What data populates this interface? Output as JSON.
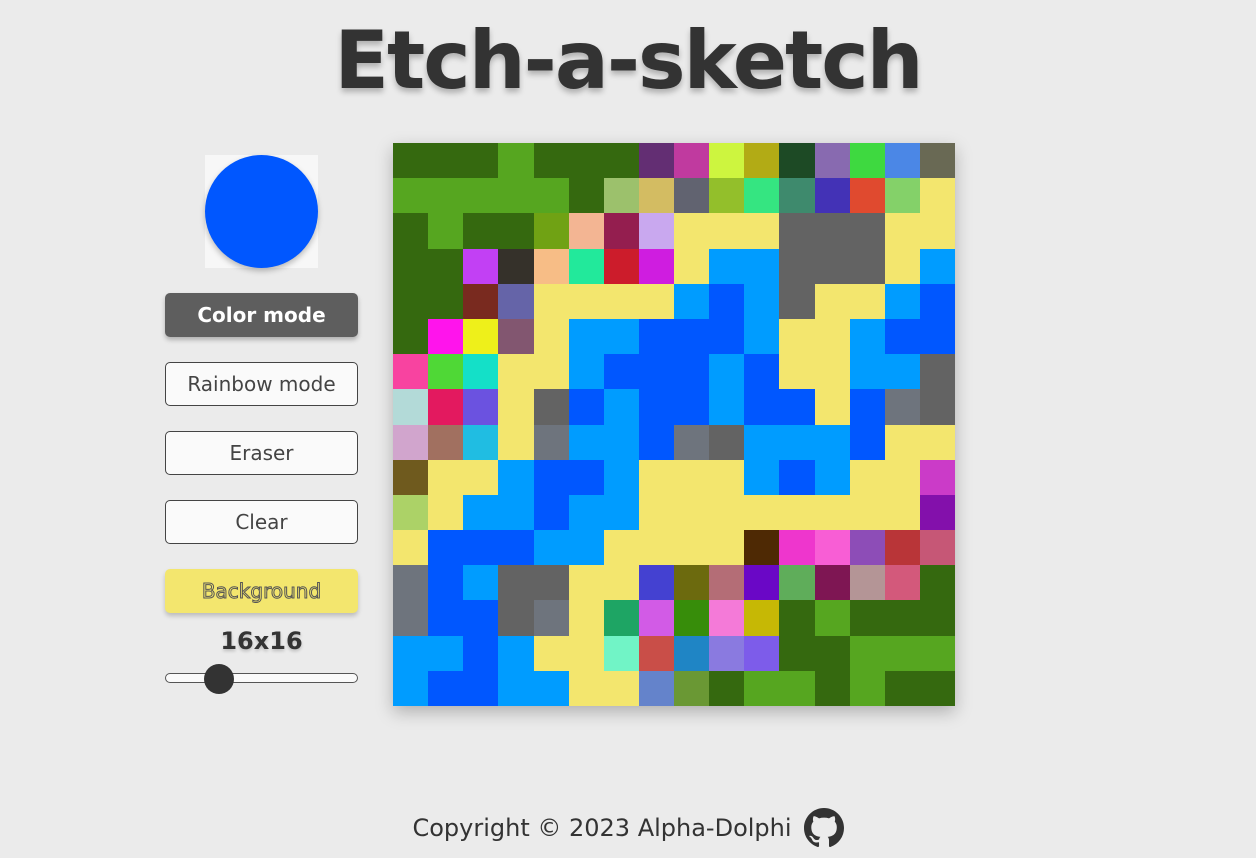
{
  "title": "Etch-a-sketch",
  "current_color": "#0057ff",
  "buttons": {
    "color_mode": "Color mode",
    "rainbow_mode": "Rainbow mode",
    "eraser": "Eraser",
    "clear": "Clear",
    "background": "Background"
  },
  "background_color": "#f3e66e",
  "grid_size_label": "16x16",
  "grid_size": 16,
  "slider": {
    "min": 1,
    "max": 64,
    "value": 16
  },
  "footer": {
    "text": "Copyright © 2023 Alpha-Dolphi",
    "icon": "github-icon"
  },
  "grid_colors": [
    [
      "#35690f",
      "#35690f",
      "#35690f",
      "#56a620",
      "#35690f",
      "#35690f",
      "#35690f",
      "#632e73",
      "#c03a9f",
      "#cdf53f",
      "#b2ab15",
      "#1d4a25",
      "#886ab0",
      "#3ed940",
      "#4b87e6",
      "#696954"
    ],
    [
      "#56a620",
      "#56a620",
      "#56a620",
      "#56a620",
      "#56a620",
      "#35690f",
      "#9cc16c",
      "#d3bc62",
      "#616370",
      "#93bf2b",
      "#35e581",
      "#3e8a6d",
      "#4332b6",
      "#e04a2f",
      "#84d169",
      "#f3e66e"
    ],
    [
      "#35690f",
      "#56a620",
      "#35690f",
      "#35690f",
      "#70a214",
      "#f3b593",
      "#941e4f",
      "#c9a8ef",
      "#f3e66e",
      "#f3e66e",
      "#f3e66e",
      "#636363",
      "#636363",
      "#636363",
      "#f3e66e",
      "#f3e66e"
    ],
    [
      "#35690f",
      "#35690f",
      "#c240f4",
      "#35312a",
      "#f7bd86",
      "#22e99b",
      "#cc1c2b",
      "#cf1de0",
      "#f3e66e",
      "#009cff",
      "#009cff",
      "#636363",
      "#636363",
      "#636363",
      "#f3e66e",
      "#009cff"
    ],
    [
      "#35690f",
      "#35690f",
      "#792a1f",
      "#6564a8",
      "#f3e66e",
      "#f3e66e",
      "#f3e66e",
      "#f3e66e",
      "#009cff",
      "#0057ff",
      "#009cff",
      "#636363",
      "#f3e66e",
      "#f3e66e",
      "#009cff",
      "#0057ff"
    ],
    [
      "#35690f",
      "#ff14ec",
      "#eef01a",
      "#825670",
      "#f3e66e",
      "#009cff",
      "#009cff",
      "#0057ff",
      "#0057ff",
      "#0057ff",
      "#009cff",
      "#f3e66e",
      "#f3e66e",
      "#009cff",
      "#0057ff",
      "#0057ff"
    ],
    [
      "#f843a0",
      "#4fd836",
      "#14e0c8",
      "#f3e66e",
      "#f3e66e",
      "#009cff",
      "#0057ff",
      "#0057ff",
      "#0057ff",
      "#009cff",
      "#0057ff",
      "#f3e66e",
      "#f3e66e",
      "#009cff",
      "#009cff",
      "#636363"
    ],
    [
      "#b3dad8",
      "#e3195f",
      "#6b52e0",
      "#f3e66e",
      "#636363",
      "#0057ff",
      "#009cff",
      "#0057ff",
      "#0057ff",
      "#009cff",
      "#0057ff",
      "#0057ff",
      "#f3e66e",
      "#0057ff",
      "#6e747d",
      "#636363"
    ],
    [
      "#d1a5cd",
      "#a17060",
      "#20bde2",
      "#f3e66e",
      "#6e747d",
      "#009cff",
      "#009cff",
      "#0057ff",
      "#6e747d",
      "#636363",
      "#009cff",
      "#009cff",
      "#009cff",
      "#0057ff",
      "#f3e66e",
      "#f3e66e"
    ],
    [
      "#6f5a1e",
      "#f3e66e",
      "#f3e66e",
      "#009cff",
      "#0057ff",
      "#0057ff",
      "#009cff",
      "#f3e66e",
      "#f3e66e",
      "#f3e66e",
      "#009cff",
      "#0057ff",
      "#009cff",
      "#f3e66e",
      "#f3e66e",
      "#cb3bc8"
    ],
    [
      "#acd267",
      "#f3e66e",
      "#009cff",
      "#009cff",
      "#0057ff",
      "#009cff",
      "#009cff",
      "#f3e66e",
      "#f3e66e",
      "#f3e66e",
      "#f3e66e",
      "#f3e66e",
      "#f3e66e",
      "#f3e66e",
      "#f3e66e",
      "#8310ab"
    ],
    [
      "#f3e66e",
      "#0057ff",
      "#0057ff",
      "#0057ff",
      "#009cff",
      "#009cff",
      "#f3e66e",
      "#f3e66e",
      "#f3e66e",
      "#f3e66e",
      "#4e2904",
      "#ee36cd",
      "#f85ed5",
      "#8d4db7",
      "#b93538",
      "#c65776"
    ],
    [
      "#6e747d",
      "#0057ff",
      "#009cff",
      "#636363",
      "#636363",
      "#f3e66e",
      "#f3e66e",
      "#4441d1",
      "#6c6a0e",
      "#b46d76",
      "#6a07c6",
      "#5fad5a",
      "#7e1653",
      "#b49596",
      "#d3597b",
      "#35690f"
    ],
    [
      "#6e747d",
      "#0057ff",
      "#0057ff",
      "#636363",
      "#6e747d",
      "#f3e66e",
      "#1ea564",
      "#d25be6",
      "#378d0a",
      "#f47ad8",
      "#c6b805",
      "#35690f",
      "#56a620",
      "#35690f",
      "#35690f",
      "#35690f"
    ],
    [
      "#009cff",
      "#009cff",
      "#0057ff",
      "#009cff",
      "#f3e66e",
      "#f3e66e",
      "#71f4c6",
      "#c94e48",
      "#1f85c5",
      "#8a7ae0",
      "#7d5cea",
      "#35690f",
      "#35690f",
      "#56a620",
      "#56a620",
      "#56a620"
    ],
    [
      "#009cff",
      "#0057ff",
      "#0057ff",
      "#009cff",
      "#009cff",
      "#f3e66e",
      "#f3e66e",
      "#6483cb",
      "#6a9834",
      "#35690f",
      "#56a620",
      "#56a620",
      "#35690f",
      "#56a620",
      "#35690f",
      "#35690f"
    ]
  ]
}
